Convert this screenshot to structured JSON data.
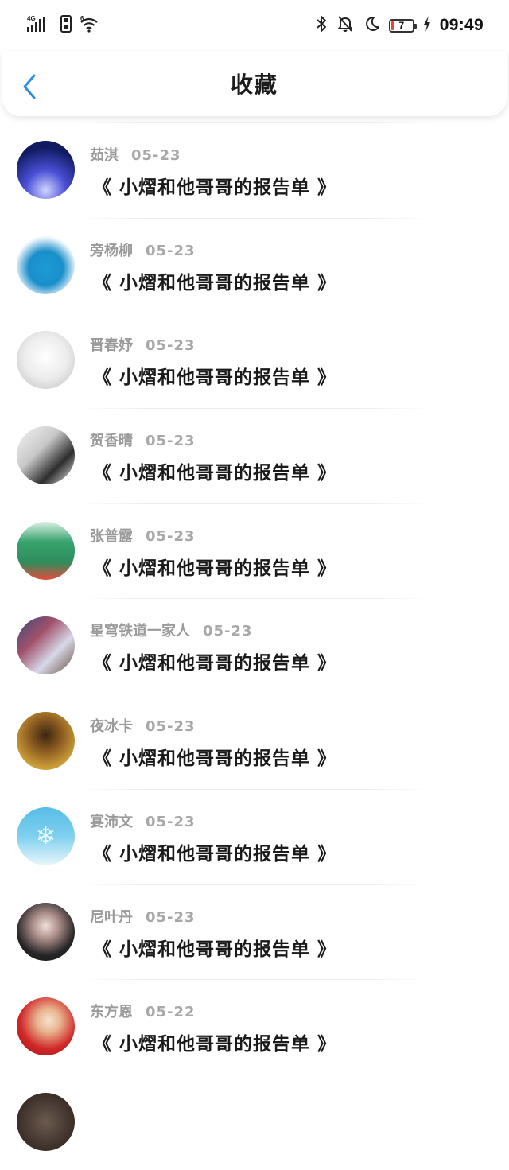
{
  "status_bar": {
    "network": "4G",
    "signal_icon": "signal-icon",
    "sim_icon": "sim-card-icon",
    "wifi_icon": "wifi-icon",
    "wifi_badge": "6",
    "bluetooth_icon": "bluetooth-icon",
    "mute_icon": "bell-off-icon",
    "dnd_icon": "moon-icon",
    "battery_level": "7",
    "charging_icon": "lightning-icon",
    "time": "09:49"
  },
  "header": {
    "back_icon": "chevron-left-icon",
    "title": "收藏",
    "accent_color": "#2f8eea"
  },
  "items": [
    {
      "author": "茹淇",
      "date": "05-23",
      "title": "《 小熠和他哥哥的报告单 》",
      "avatar_icon": "group-photo-icon"
    },
    {
      "author": "旁杨柳",
      "date": "05-23",
      "title": "《 小熠和他哥哥的报告单 》",
      "avatar_icon": "bottle-icon"
    },
    {
      "author": "晋春妤",
      "date": "05-23",
      "title": "《 小熠和他哥哥的报告单 》",
      "avatar_icon": "cat-icon"
    },
    {
      "author": "贺香晴",
      "date": "05-23",
      "title": "《 小熠和他哥哥的报告单 》",
      "avatar_icon": "anime-portrait-icon"
    },
    {
      "author": "张普露",
      "date": "05-23",
      "title": "《 小熠和他哥哥的报告单 》",
      "avatar_icon": "promo-banner-icon"
    },
    {
      "author": "星穹铁道一家人",
      "date": "05-23",
      "title": "《 小熠和他哥哥的报告单 》",
      "avatar_icon": "game-characters-icon"
    },
    {
      "author": "夜冰卡",
      "date": "05-23",
      "title": "《 小熠和他哥哥的报告单 》",
      "avatar_icon": "robot-icon"
    },
    {
      "author": "宴沛文",
      "date": "05-23",
      "title": "《 小熠和他哥哥的报告单 》",
      "avatar_icon": "snowflake-icon"
    },
    {
      "author": "尼叶丹",
      "date": "05-23",
      "title": "《 小熠和他哥哥的报告单 》",
      "avatar_icon": "portrait-icon"
    },
    {
      "author": "东方恩",
      "date": "05-22",
      "title": "《 小熠和他哥哥的报告单 》",
      "avatar_icon": "portrait-icon"
    },
    {
      "author": "",
      "date": "",
      "title": "",
      "avatar_icon": "portrait-icon"
    }
  ]
}
